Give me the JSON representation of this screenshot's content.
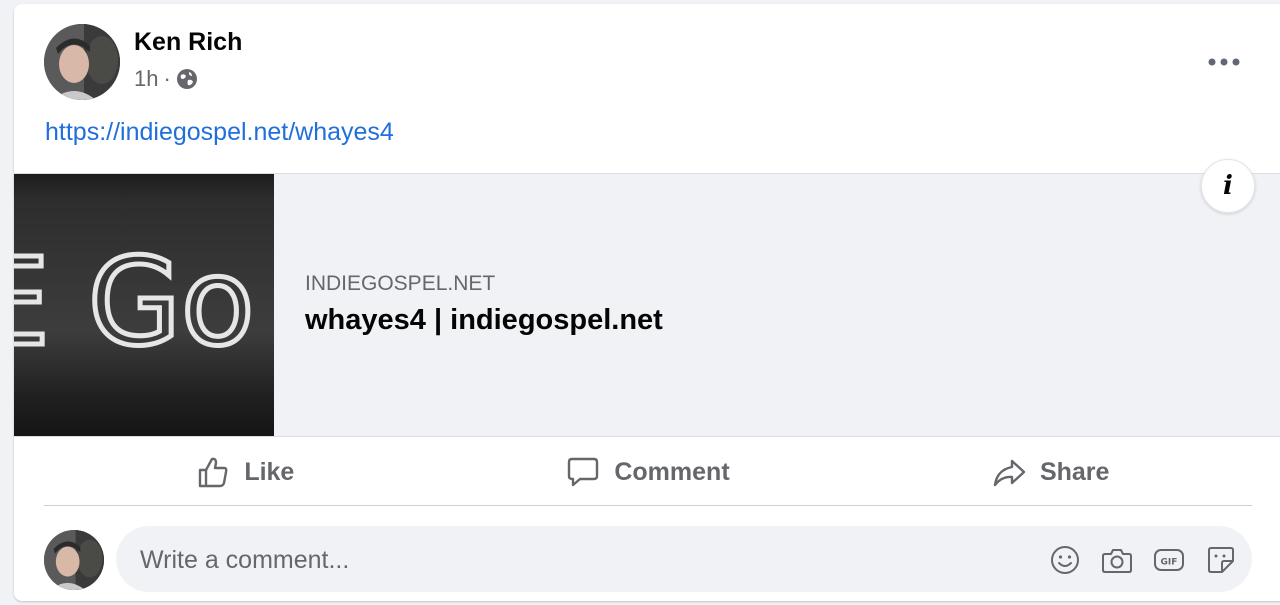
{
  "post": {
    "author": "Ken Rich",
    "time": "1h",
    "separator": "·",
    "audience_icon": "globe-icon",
    "menu_icon": "more-options-icon",
    "link_text": "https://indiegospel.net/whayes4"
  },
  "preview": {
    "image_text": "E Go",
    "domain": "INDIEGOSPEL.NET",
    "title": "whayes4 | indiegospel.net",
    "info_label": "i"
  },
  "actions": [
    {
      "label": "Like",
      "icon": "thumbs-up-icon"
    },
    {
      "label": "Comment",
      "icon": "comment-bubble-icon"
    },
    {
      "label": "Share",
      "icon": "share-arrow-icon"
    }
  ],
  "composer": {
    "placeholder": "Write a comment...",
    "tools": [
      "emoji-icon",
      "camera-icon",
      "gif-icon",
      "sticker-icon"
    ],
    "gif_label": "GIF"
  },
  "colors": {
    "link": "#216fdb",
    "secondary_text": "#65676b",
    "background": "#f0f2f5"
  }
}
